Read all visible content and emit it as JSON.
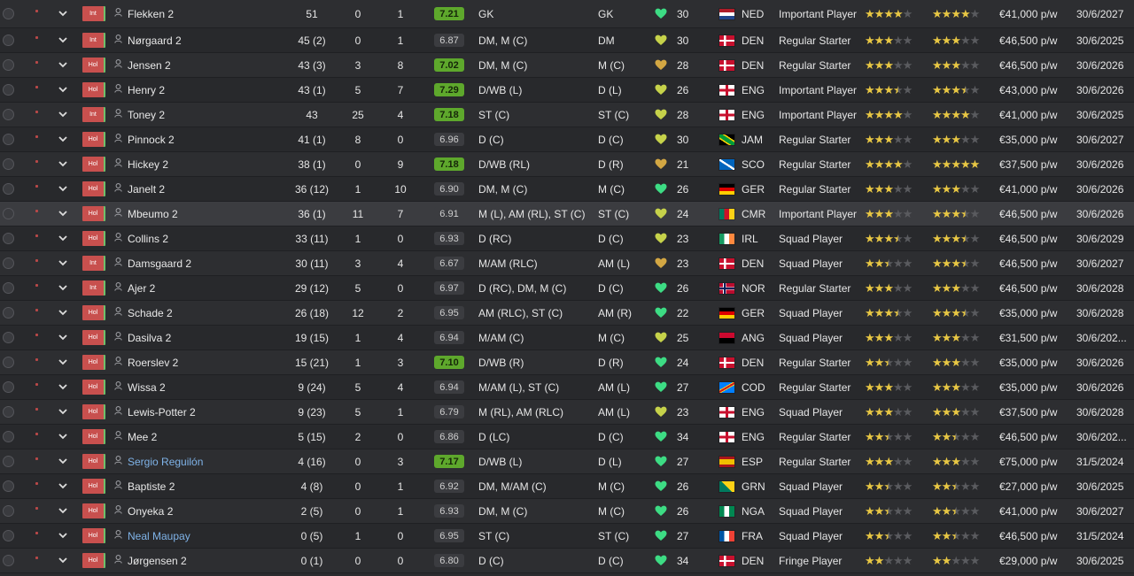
{
  "colors": {
    "good_rating": "#5ea82c",
    "star": "#e8c744",
    "status_badge": "#c8504e",
    "link_name": "#7fb3e8"
  },
  "icons": {
    "row_toggle": "chevron-down-icon",
    "person": "person-icon",
    "morale": "heart-icon"
  },
  "players": [
    {
      "status": "Int",
      "name": "Flekken 2",
      "apps": "51",
      "gls": "0",
      "ast": "1",
      "rating": "7.21",
      "pos": "GK",
      "best": "GK",
      "heart": "#3ddc84",
      "age": "30",
      "nat": "NED",
      "role": "Important Player",
      "ca": 4,
      "pa": 4,
      "wage": "€41,000 p/w",
      "exp": "30/6/2027",
      "flag": "ned"
    },
    {
      "status": "Int",
      "name": "Nørgaard 2",
      "apps": "45 (2)",
      "gls": "0",
      "ast": "1",
      "rating": "6.87",
      "pos": "DM, M (C)",
      "best": "DM",
      "heart": "#c6d24a",
      "age": "30",
      "nat": "DEN",
      "role": "Regular Starter",
      "ca": 3,
      "pa": 3,
      "wage": "€46,500 p/w",
      "exp": "30/6/2025",
      "flag": "den"
    },
    {
      "status": "Hol",
      "name": "Jensen 2",
      "apps": "43 (3)",
      "gls": "3",
      "ast": "8",
      "rating": "7.02",
      "pos": "DM, M (C)",
      "best": "M (C)",
      "heart": "#d3a743",
      "age": "28",
      "nat": "DEN",
      "role": "Regular Starter",
      "ca": 3,
      "pa": 3,
      "wage": "€46,500 p/w",
      "exp": "30/6/2026",
      "flag": "den"
    },
    {
      "status": "Hol",
      "name": "Henry 2",
      "apps": "43 (1)",
      "gls": "5",
      "ast": "7",
      "rating": "7.29",
      "pos": "D/WB (L)",
      "best": "D (L)",
      "heart": "#c6d24a",
      "age": "26",
      "nat": "ENG",
      "role": "Important Player",
      "ca": 3.5,
      "pa": 3.5,
      "wage": "€43,000 p/w",
      "exp": "30/6/2026",
      "flag": "eng"
    },
    {
      "status": "Int",
      "name": "Toney 2",
      "apps": "43",
      "gls": "25",
      "ast": "4",
      "rating": "7.18",
      "pos": "ST (C)",
      "best": "ST (C)",
      "heart": "#c6d24a",
      "age": "28",
      "nat": "ENG",
      "role": "Important Player",
      "ca": 4,
      "pa": 4,
      "wage": "€41,000 p/w",
      "exp": "30/6/2025",
      "flag": "eng"
    },
    {
      "status": "Hol",
      "name": "Pinnock 2",
      "apps": "41 (1)",
      "gls": "8",
      "ast": "0",
      "rating": "6.96",
      "pos": "D (C)",
      "best": "D (C)",
      "heart": "#c6d24a",
      "age": "30",
      "nat": "JAM",
      "role": "Regular Starter",
      "ca": 3,
      "pa": 3,
      "wage": "€35,000 p/w",
      "exp": "30/6/2027",
      "flag": "jam"
    },
    {
      "status": "Hol",
      "name": "Hickey 2",
      "apps": "38 (1)",
      "gls": "0",
      "ast": "9",
      "rating": "7.18",
      "pos": "D/WB (RL)",
      "best": "D (R)",
      "heart": "#d3a743",
      "age": "21",
      "nat": "SCO",
      "role": "Regular Starter",
      "ca": 4,
      "pa": 5,
      "pa_white": true,
      "wage": "€37,500 p/w",
      "exp": "30/6/2026",
      "flag": "sco"
    },
    {
      "status": "Hol",
      "name": "Janelt 2",
      "apps": "36 (12)",
      "gls": "1",
      "ast": "10",
      "rating": "6.90",
      "pos": "DM, M (C)",
      "best": "M (C)",
      "heart": "#3ddc84",
      "age": "26",
      "nat": "GER",
      "role": "Regular Starter",
      "ca": 3,
      "pa": 3,
      "wage": "€41,000 p/w",
      "exp": "30/6/2026",
      "flag": "ger"
    },
    {
      "status": "Hol",
      "name": "Mbeumo 2",
      "apps": "36 (1)",
      "gls": "11",
      "ast": "7",
      "rating": "6.91",
      "pos": "M (L), AM (RL), ST (C)",
      "best": "ST (C)",
      "heart": "#c6d24a",
      "age": "24",
      "nat": "CMR",
      "role": "Important Player",
      "ca": 3,
      "pa": 3.5,
      "wage": "€46,500 p/w",
      "exp": "30/6/2026",
      "flag": "cmr",
      "highlight": true
    },
    {
      "status": "Hol",
      "name": "Collins 2",
      "apps": "33 (11)",
      "gls": "1",
      "ast": "0",
      "rating": "6.93",
      "pos": "D (RC)",
      "best": "D (C)",
      "heart": "#c6d24a",
      "age": "23",
      "nat": "IRL",
      "role": "Squad Player",
      "ca": 3.5,
      "pa": 3.5,
      "wage": "€46,500 p/w",
      "exp": "30/6/2029",
      "flag": "irl"
    },
    {
      "status": "Int",
      "name": "Damsgaard 2",
      "apps": "30 (11)",
      "gls": "3",
      "ast": "4",
      "rating": "6.67",
      "pos": "M/AM (RLC)",
      "best": "AM (L)",
      "heart": "#d3a743",
      "age": "23",
      "nat": "DEN",
      "role": "Squad Player",
      "ca": 2.5,
      "pa": 3.5,
      "wage": "€46,500 p/w",
      "exp": "30/6/2027",
      "flag": "den"
    },
    {
      "status": "Int",
      "name": "Ajer 2",
      "apps": "29 (12)",
      "gls": "5",
      "ast": "0",
      "rating": "6.97",
      "pos": "D (RC), DM, M (C)",
      "best": "D (C)",
      "heart": "#3ddc84",
      "age": "26",
      "nat": "NOR",
      "role": "Regular Starter",
      "ca": 3,
      "pa": 3,
      "wage": "€46,500 p/w",
      "exp": "30/6/2028",
      "flag": "nor"
    },
    {
      "status": "Hol",
      "name": "Schade 2",
      "apps": "26 (18)",
      "gls": "12",
      "ast": "2",
      "rating": "6.95",
      "pos": "AM (RLC), ST (C)",
      "best": "AM (R)",
      "heart": "#3ddc84",
      "age": "22",
      "nat": "GER",
      "role": "Squad Player",
      "ca": 3.5,
      "pa": 3.5,
      "wage": "€35,000 p/w",
      "exp": "30/6/2028",
      "flag": "ger"
    },
    {
      "status": "Hol",
      "name": "Dasilva 2",
      "apps": "19 (15)",
      "gls": "1",
      "ast": "4",
      "rating": "6.94",
      "pos": "M/AM (C)",
      "best": "M (C)",
      "heart": "#c6d24a",
      "age": "25",
      "nat": "ANG",
      "role": "Squad Player",
      "ca": 3,
      "pa": 3,
      "wage": "€31,500 p/w",
      "exp": "30/6/202...",
      "flag": "ang"
    },
    {
      "status": "Hol",
      "name": "Roerslev 2",
      "apps": "15 (21)",
      "gls": "1",
      "ast": "3",
      "rating": "7.10",
      "pos": "D/WB (R)",
      "best": "D (R)",
      "heart": "#3ddc84",
      "age": "24",
      "nat": "DEN",
      "role": "Regular Starter",
      "ca": 2.5,
      "pa": 3,
      "wage": "€35,000 p/w",
      "exp": "30/6/2026",
      "flag": "den"
    },
    {
      "status": "Hol",
      "name": "Wissa 2",
      "apps": "9 (24)",
      "gls": "5",
      "ast": "4",
      "rating": "6.94",
      "pos": "M/AM (L), ST (C)",
      "best": "AM (L)",
      "heart": "#3ddc84",
      "age": "27",
      "nat": "COD",
      "role": "Regular Starter",
      "ca": 3,
      "pa": 3,
      "wage": "€35,000 p/w",
      "exp": "30/6/2026",
      "flag": "cod"
    },
    {
      "status": "Hol",
      "name": "Lewis-Potter 2",
      "apps": "9 (23)",
      "gls": "5",
      "ast": "1",
      "rating": "6.79",
      "pos": "M (RL), AM (RLC)",
      "best": "AM (L)",
      "heart": "#c6d24a",
      "age": "23",
      "nat": "ENG",
      "role": "Squad Player",
      "ca": 3,
      "pa": 3,
      "wage": "€37,500 p/w",
      "exp": "30/6/2028",
      "flag": "eng"
    },
    {
      "status": "Hol",
      "name": "Mee 2",
      "apps": "5 (15)",
      "gls": "2",
      "ast": "0",
      "rating": "6.86",
      "pos": "D (LC)",
      "best": "D (C)",
      "heart": "#3ddc84",
      "age": "34",
      "nat": "ENG",
      "role": "Regular Starter",
      "ca": 2.5,
      "pa": 2.5,
      "wage": "€46,500 p/w",
      "exp": "30/6/202...",
      "flag": "eng"
    },
    {
      "status": "Hol",
      "name": "Sergio Reguilón",
      "apps": "4 (16)",
      "gls": "0",
      "ast": "3",
      "rating": "7.17",
      "pos": "D/WB (L)",
      "best": "D (L)",
      "heart": "#3ddc84",
      "age": "27",
      "nat": "ESP",
      "role": "Regular Starter",
      "ca": 3,
      "pa": 3,
      "wage": "€75,000 p/w",
      "exp": "31/5/2024",
      "flag": "esp",
      "link": true
    },
    {
      "status": "Hol",
      "name": "Baptiste 2",
      "apps": "4 (8)",
      "gls": "0",
      "ast": "1",
      "rating": "6.92",
      "pos": "DM, M/AM (C)",
      "best": "M (C)",
      "heart": "#3ddc84",
      "age": "26",
      "nat": "GRN",
      "role": "Squad Player",
      "ca": 2.5,
      "pa": 2.5,
      "wage": "€27,000 p/w",
      "exp": "30/6/2025",
      "flag": "grn"
    },
    {
      "status": "Hol",
      "name": "Onyeka 2",
      "apps": "2 (5)",
      "gls": "0",
      "ast": "1",
      "rating": "6.93",
      "pos": "DM, M (C)",
      "best": "M (C)",
      "heart": "#3ddc84",
      "age": "26",
      "nat": "NGA",
      "role": "Squad Player",
      "ca": 2.5,
      "pa": 2.5,
      "wage": "€41,000 p/w",
      "exp": "30/6/2027",
      "flag": "nga"
    },
    {
      "status": "Hol",
      "name": "Neal Maupay",
      "apps": "0 (5)",
      "gls": "1",
      "ast": "0",
      "rating": "6.95",
      "pos": "ST (C)",
      "best": "ST (C)",
      "heart": "#3ddc84",
      "age": "27",
      "nat": "FRA",
      "role": "Squad Player",
      "ca": 2.5,
      "pa": 2.5,
      "wage": "€46,500 p/w",
      "exp": "31/5/2024",
      "flag": "fra",
      "link": true
    },
    {
      "status": "Hol",
      "name": "Jørgensen 2",
      "apps": "0 (1)",
      "gls": "0",
      "ast": "0",
      "rating": "6.80",
      "pos": "D (C)",
      "best": "D (C)",
      "heart": "#3ddc84",
      "age": "34",
      "nat": "DEN",
      "role": "Fringe Player",
      "ca": 2,
      "pa": 2,
      "wage": "€29,000 p/w",
      "exp": "30/6/2025",
      "flag": "den"
    }
  ]
}
